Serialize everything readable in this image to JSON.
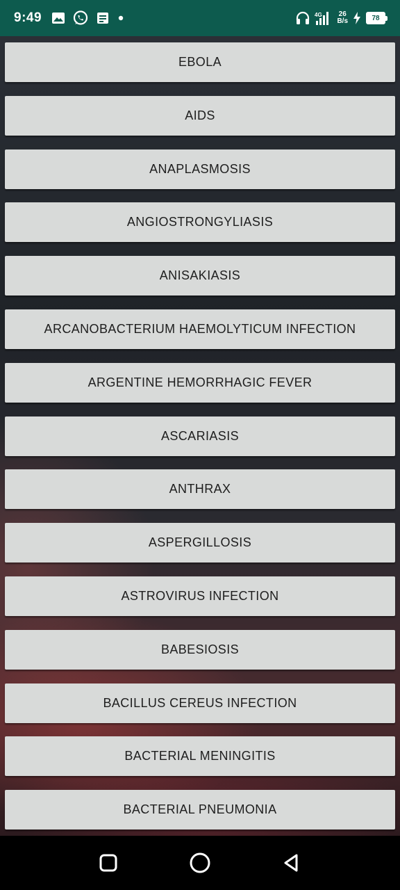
{
  "status_bar": {
    "time": "9:49",
    "network_speed_value": "26",
    "network_speed_unit": "B/s",
    "battery_level": "78",
    "left_icons": [
      "gallery-icon",
      "whatsapp-icon",
      "notes-icon",
      "dot-icon"
    ],
    "right_icons": [
      "headphones-icon",
      "signal-icon",
      "charging-icon",
      "battery-icon"
    ]
  },
  "diseases": [
    {
      "label": "EBOLA"
    },
    {
      "label": "AIDS"
    },
    {
      "label": "ANAPLASMOSIS"
    },
    {
      "label": "ANGIOSTRONGYLIASIS"
    },
    {
      "label": "ANISAKIASIS"
    },
    {
      "label": "ARCANOBACTERIUM HAEMOLYTICUM INFECTION"
    },
    {
      "label": "ARGENTINE HEMORRHAGIC FEVER"
    },
    {
      "label": "ASCARIASIS"
    },
    {
      "label": "ANTHRAX"
    },
    {
      "label": "ASPERGILLOSIS"
    },
    {
      "label": "ASTROVIRUS INFECTION"
    },
    {
      "label": "BABESIOSIS"
    },
    {
      "label": "BACILLUS CEREUS INFECTION"
    },
    {
      "label": "BACTERIAL MENINGITIS"
    },
    {
      "label": "BACTERIAL PNEUMONIA"
    }
  ],
  "nav_bar": {
    "buttons": [
      "recents-square-icon",
      "home-circle-icon",
      "back-triangle-icon"
    ]
  },
  "colors": {
    "status_bar": "#0d5b4e",
    "button_bg": "#d8dad9",
    "button_text": "#1e1e1e",
    "nav_bar": "#000000"
  }
}
